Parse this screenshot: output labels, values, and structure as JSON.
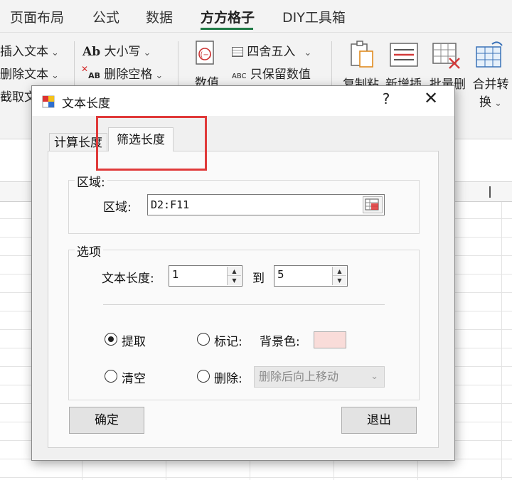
{
  "ribbon": {
    "tabs": [
      "页面布局",
      "公式",
      "数据",
      "方方格子",
      "DIY工具箱"
    ],
    "active_tab": "方方格子",
    "accent_color": "#1f7a46",
    "items": {
      "insert_text": "插入文本",
      "delete_text": "删除文本",
      "truncate_text": "截取文",
      "case_prefix": "Ab",
      "case": "大小写",
      "delete_space_prefix": "AB",
      "delete_space": "删除空格",
      "round_label": "四舍五入",
      "keep_number_prefix": "ABC",
      "keep_number": "只保留数值",
      "value_label": "数值",
      "copy_paste": "复制粘",
      "new_insert": "新增插",
      "batch_delete": "批量删",
      "merge_convert_1": "合并转",
      "merge_convert_2": "换"
    }
  },
  "dialog": {
    "title": "文本长度",
    "help_label": "?",
    "close_label": "✕",
    "tabs": [
      "计算长度",
      "筛选长度"
    ],
    "active_tab": "筛选长度",
    "region_group": {
      "title": "区域:",
      "label": "区域:",
      "value": "D2:F11"
    },
    "options_group": {
      "title": "选项",
      "length_label": "文本长度:",
      "from_value": "1",
      "to_label": "到",
      "to_value": "5",
      "extract_label": "提取",
      "mark_label": "标记:",
      "bg_color_label": "背景色:",
      "bg_color": "#f9dcd9",
      "clear_label": "清空",
      "delete_label": "删除:",
      "delete_option": "删除后向上移动",
      "selected_action": "提取"
    },
    "ok_label": "确定",
    "exit_label": "退出"
  },
  "annotation": {
    "highlight_color": "#e03a3a"
  }
}
